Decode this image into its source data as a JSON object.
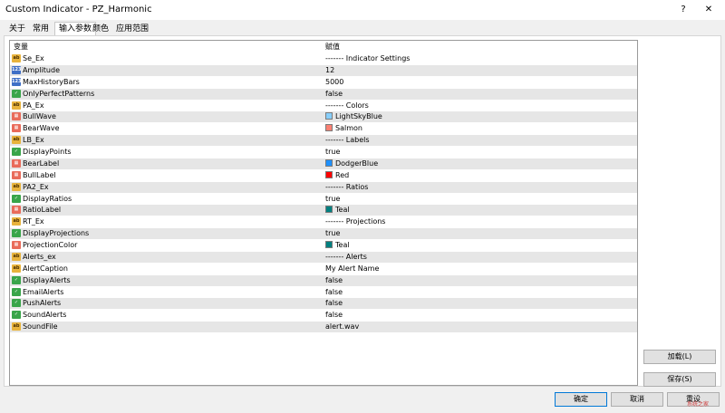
{
  "window": {
    "title": "Custom Indicator - PZ_Harmonic",
    "help_label": "?",
    "close_label": "✕"
  },
  "tabs": [
    {
      "label": "关于"
    },
    {
      "label": "常用"
    },
    {
      "label": "输入参数"
    },
    {
      "label": "颜色"
    },
    {
      "label": "应用范围"
    }
  ],
  "grid": {
    "headers": {
      "variable": "变量",
      "value": "赋值"
    },
    "rows": [
      {
        "icon": "abc",
        "name": "Se_Ex",
        "value": "------- Indicator Settings"
      },
      {
        "icon": "num",
        "name": "Amplitude",
        "value": "12"
      },
      {
        "icon": "num",
        "name": "MaxHistoryBars",
        "value": "5000"
      },
      {
        "icon": "bool",
        "name": "OnlyPerfectPatterns",
        "value": "false"
      },
      {
        "icon": "abc",
        "name": "PA_Ex",
        "value": "------- Colors"
      },
      {
        "icon": "col",
        "name": "BullWave",
        "value": "LightSkyBlue",
        "swatch": "#87cefa"
      },
      {
        "icon": "col",
        "name": "BearWave",
        "value": "Salmon",
        "swatch": "#fa8072"
      },
      {
        "icon": "abc",
        "name": "LB_Ex",
        "value": "------- Labels"
      },
      {
        "icon": "bool",
        "name": "DisplayPoints",
        "value": "true"
      },
      {
        "icon": "col",
        "name": "BearLabel",
        "value": "DodgerBlue",
        "swatch": "#1e90ff"
      },
      {
        "icon": "col",
        "name": "BullLabel",
        "value": "Red",
        "swatch": "#ff0000"
      },
      {
        "icon": "abc",
        "name": "PA2_Ex",
        "value": "------- Ratios"
      },
      {
        "icon": "bool",
        "name": "DisplayRatios",
        "value": "true"
      },
      {
        "icon": "col",
        "name": "RatioLabel",
        "value": "Teal",
        "swatch": "#008080"
      },
      {
        "icon": "abc",
        "name": "RT_Ex",
        "value": "------- Projections"
      },
      {
        "icon": "bool",
        "name": "DisplayProjections",
        "value": "true"
      },
      {
        "icon": "col",
        "name": "ProjectionColor",
        "value": "Teal",
        "swatch": "#008080"
      },
      {
        "icon": "abc",
        "name": "Alerts_ex",
        "value": "------- Alerts"
      },
      {
        "icon": "abc",
        "name": "AlertCaption",
        "value": "My Alert Name"
      },
      {
        "icon": "bool",
        "name": "DisplayAlerts",
        "value": "false"
      },
      {
        "icon": "bool",
        "name": "EmailAlerts",
        "value": "false"
      },
      {
        "icon": "bool",
        "name": "PushAlerts",
        "value": "false"
      },
      {
        "icon": "bool",
        "name": "SoundAlerts",
        "value": "false"
      },
      {
        "icon": "abc",
        "name": "SoundFile",
        "value": "alert.wav"
      }
    ]
  },
  "side_buttons": {
    "load": "加载(L)",
    "save": "保存(S)"
  },
  "footer": {
    "ok": "确定",
    "cancel": "取消",
    "reset": "重设"
  },
  "watermark": "系统之家"
}
